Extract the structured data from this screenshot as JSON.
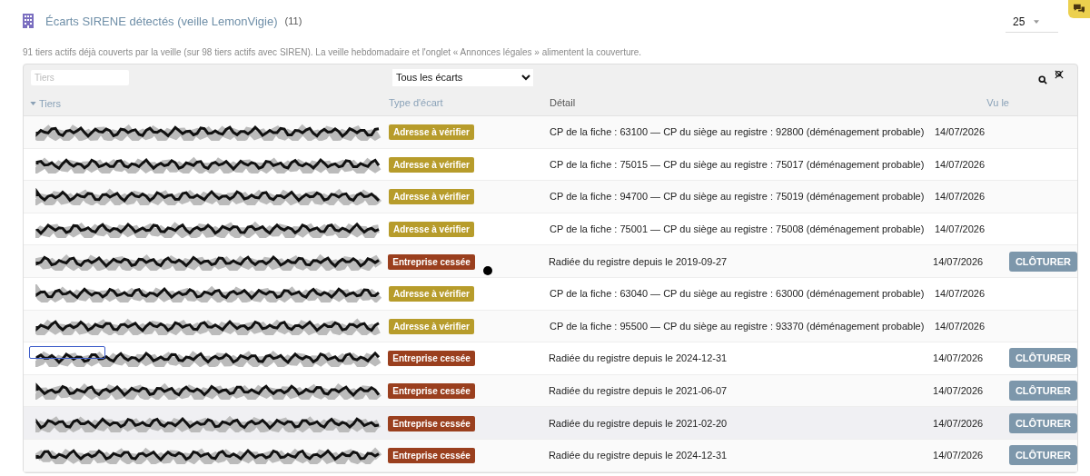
{
  "header": {
    "title": "Écarts SIRENE détectés (veille LemonVigie)",
    "count": "(11)",
    "page_size": "25"
  },
  "description": "91 tiers actifs déjà couverts par la veille (sur 98 tiers actifs avec SIREN). La veille hebdomadaire et l'onglet « Annonces légales » alimentent la couverture.",
  "filters": {
    "tiers_placeholder": "Tiers",
    "type_value": "Tous les écarts"
  },
  "columns": [
    {
      "label": "Tiers",
      "sorted": true
    },
    {
      "label": "Type d'écart",
      "sorted": false
    },
    {
      "label": "Détail",
      "sorted": false
    },
    {
      "label": "Vu le",
      "sorted": false
    }
  ],
  "rows": [
    {
      "type": {
        "kind": "address",
        "label": "Adresse à vérifier"
      },
      "detail": "CP de la fiche : 63100 — CP du siège au registre : 92800 (déménagement probable)",
      "seen": "14/07/2026",
      "action": null,
      "highlighted": false,
      "focused": false
    },
    {
      "type": {
        "kind": "address",
        "label": "Adresse à vérifier"
      },
      "detail": "CP de la fiche : 75015 — CP du siège au registre : 75017 (déménagement probable)",
      "seen": "14/07/2026",
      "action": null,
      "highlighted": false,
      "focused": false
    },
    {
      "type": {
        "kind": "address",
        "label": "Adresse à vérifier"
      },
      "detail": "CP de la fiche : 94700 — CP du siège au registre : 75019 (déménagement probable)",
      "seen": "14/07/2026",
      "action": null,
      "highlighted": false,
      "focused": false
    },
    {
      "type": {
        "kind": "address",
        "label": "Adresse à vérifier"
      },
      "detail": "CP de la fiche : 75001 — CP du siège au registre : 75008 (déménagement probable)",
      "seen": "14/07/2026",
      "action": null,
      "highlighted": false,
      "focused": false
    },
    {
      "type": {
        "kind": "ceased",
        "label": "Entreprise cessée"
      },
      "detail": "Radiée du registre depuis le 2019-09-27",
      "seen": "14/07/2026",
      "action": "CLÔTURER",
      "highlighted": false,
      "focused": false
    },
    {
      "type": {
        "kind": "address",
        "label": "Adresse à vérifier"
      },
      "detail": "CP de la fiche : 63040 — CP du siège au registre : 63000 (déménagement probable)",
      "seen": "14/07/2026",
      "action": null,
      "highlighted": false,
      "focused": false
    },
    {
      "type": {
        "kind": "address",
        "label": "Adresse à vérifier"
      },
      "detail": "CP de la fiche : 95500 — CP du siège au registre : 93370 (déménagement probable)",
      "seen": "14/07/2026",
      "action": null,
      "highlighted": false,
      "focused": false
    },
    {
      "type": {
        "kind": "ceased",
        "label": "Entreprise cessée"
      },
      "detail": "Radiée du registre depuis le 2024-12-31",
      "seen": "14/07/2026",
      "action": "CLÔTURER",
      "highlighted": false,
      "focused": true
    },
    {
      "type": {
        "kind": "ceased",
        "label": "Entreprise cessée"
      },
      "detail": "Radiée du registre depuis le 2021-06-07",
      "seen": "14/07/2026",
      "action": "CLÔTURER",
      "highlighted": false,
      "focused": false
    },
    {
      "type": {
        "kind": "ceased",
        "label": "Entreprise cessée"
      },
      "detail": "Radiée du registre depuis le 2021-02-20",
      "seen": "14/07/2026",
      "action": "CLÔTURER",
      "highlighted": true,
      "focused": false
    },
    {
      "type": {
        "kind": "ceased",
        "label": "Entreprise cessée"
      },
      "detail": "Radiée du registre depuis le 2024-12-31",
      "seen": "14/07/2026",
      "action": "CLÔTURER",
      "highlighted": false,
      "focused": false
    }
  ]
}
